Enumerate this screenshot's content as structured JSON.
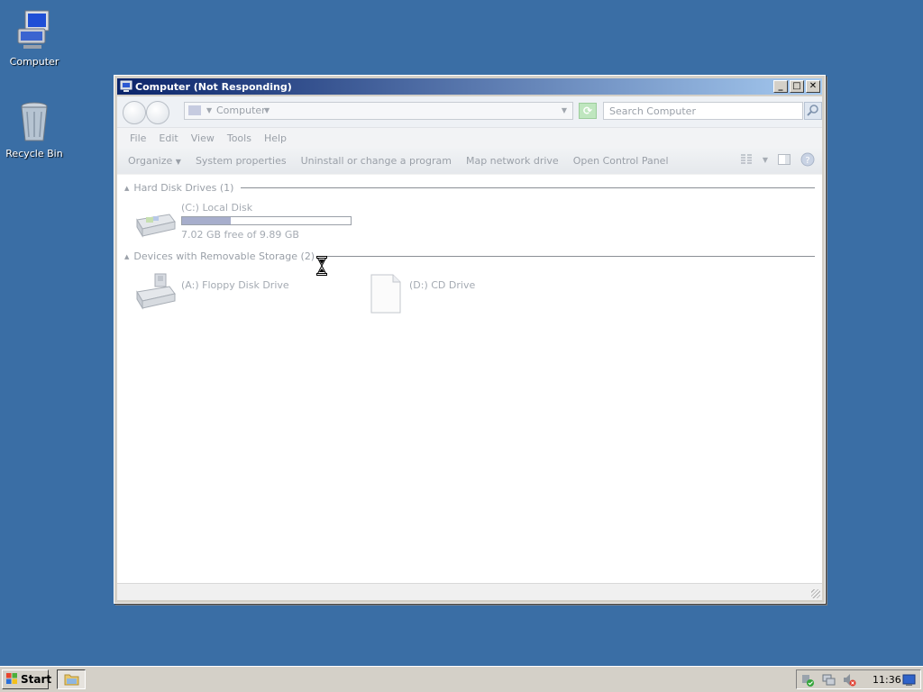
{
  "desktop": {
    "icons": [
      {
        "label": "Computer",
        "icon": "computer-icon"
      },
      {
        "label": "Recycle Bin",
        "icon": "recycle-bin-icon"
      }
    ]
  },
  "window": {
    "title": "Computer (Not Responding)",
    "address": {
      "crumb": "Computer"
    },
    "search": {
      "placeholder": "Search Computer"
    },
    "menu": [
      "File",
      "Edit",
      "View",
      "Tools",
      "Help"
    ],
    "commands": [
      "Organize",
      "System properties",
      "Uninstall or change a program",
      "Map network drive",
      "Open Control Panel"
    ],
    "groups": [
      {
        "header": "Hard Disk Drives (1)",
        "items": [
          {
            "name": "(C:) Local Disk",
            "free": "7.02 GB free of 9.89 GB",
            "used_fraction": 0.29
          }
        ]
      },
      {
        "header": "Devices with Removable Storage (2)",
        "items": [
          {
            "name": "(A:) Floppy Disk Drive"
          },
          {
            "name": "(D:) CD Drive"
          }
        ]
      }
    ]
  },
  "taskbar": {
    "start_label": "Start",
    "clock": "11:36"
  }
}
